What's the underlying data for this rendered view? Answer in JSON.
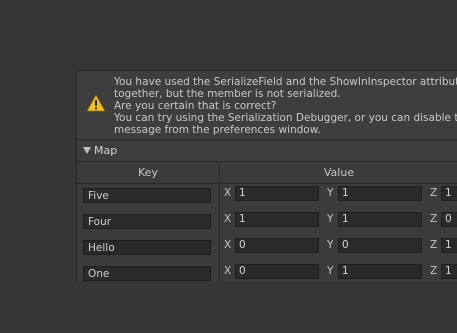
{
  "warning": {
    "lines": [
      "You have used the SerializeField and the ShowInInspector attributes",
      "together, but the member is not serialized.",
      "Are you certain that is correct?",
      "You can try using the Serialization Debugger, or you can disable this",
      "message from the preferences window."
    ],
    "icon": "warning-icon"
  },
  "map": {
    "label": "Map",
    "columns": {
      "key": "Key",
      "value": "Value"
    },
    "rows": [
      {
        "key": "Five",
        "x": "1",
        "y": "1",
        "z": "1"
      },
      {
        "key": "Four",
        "x": "1",
        "y": "1",
        "z": "0"
      },
      {
        "key": "Hello",
        "x": "0",
        "y": "0",
        "z": "1"
      },
      {
        "key": "One",
        "x": "0",
        "y": "1",
        "z": "1"
      }
    ],
    "axis_labels": {
      "x": "X",
      "y": "Y",
      "z": "Z"
    }
  },
  "colors": {
    "background": "#363636",
    "panel": "#3b3b3b",
    "field": "#2a2a2a",
    "warning_yellow": "#f0c419"
  }
}
